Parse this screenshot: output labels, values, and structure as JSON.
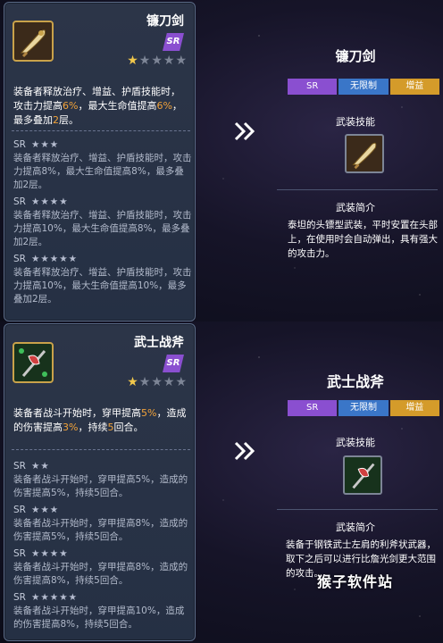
{
  "top": {
    "card": {
      "name": "镰刀剑",
      "rarity": "SR",
      "stars_on": 1,
      "stars_total": 5,
      "desc_parts": [
        "装备者释放治疗、增益、护盾技能时，攻击力提高",
        "6%",
        "，最大生命值提高",
        "6%",
        "，最多叠加",
        "2",
        "层。"
      ],
      "tiers": [
        {
          "head": "SR",
          "stars": "★★★",
          "text": "装备者释放治疗、增益、护盾技能时，攻击力提高8%，最大生命值提高8%，最多叠加2层。"
        },
        {
          "head": "SR",
          "stars": "★★★★",
          "text": "装备者释放治疗、增益、护盾技能时，攻击力提高10%，最大生命值提高8%，最多叠加2层。"
        },
        {
          "head": "SR",
          "stars": "★★★★★",
          "text": "装备者释放治疗、增益、护盾技能时，攻击力提高10%，最大生命值提高10%，最多叠加2层。"
        }
      ]
    },
    "right": {
      "title": "镰刀剑",
      "tags": [
        "SR",
        "无限制",
        "增益"
      ],
      "skill_label": "武装技能",
      "intro_label": "武装简介",
      "intro": "泰坦的头镖型武装，平时安置在头部上，在使用时会自动弹出，具有强大的攻击力。"
    }
  },
  "bottom": {
    "card": {
      "name": "武士战斧",
      "rarity": "SR",
      "stars_on": 1,
      "stars_total": 5,
      "desc_parts": [
        "装备者战斗开始时，穿甲提高",
        "5%",
        "，造成的伤害提高",
        "3%",
        "，持续",
        "5",
        "回合。"
      ],
      "tiers": [
        {
          "head": "SR",
          "stars": "★★",
          "text": "装备者战斗开始时，穿甲提高5%，造成的伤害提高5%，持续5回合。"
        },
        {
          "head": "SR",
          "stars": "★★★",
          "text": "装备者战斗开始时，穿甲提高8%，造成的伤害提高5%，持续5回合。"
        },
        {
          "head": "SR",
          "stars": "★★★★",
          "text": "装备者战斗开始时，穿甲提高8%，造成的伤害提高8%，持续5回合。"
        },
        {
          "head": "SR",
          "stars": "★★★★★",
          "text": "装备者战斗开始时，穿甲提高10%，造成的伤害提高8%，持续5回合。"
        }
      ]
    },
    "right": {
      "title": "武士战斧",
      "tags": [
        "SR",
        "无限制",
        "增益"
      ],
      "skill_label": "武装技能",
      "intro_label": "武装简介",
      "intro": "装备于钢铁武士左肩的利斧状武器，取下之后可以进行比詹光剑更大范围的攻击。"
    }
  },
  "watermark": "猴子软件站",
  "icons": {
    "scythe": "scythe-sword-icon",
    "axe": "battle-axe-icon",
    "arrow": "double-chevron-right-icon",
    "star": "star-icon"
  },
  "colors": {
    "highlight": "#f2a33a",
    "star_on": "#f2c84b",
    "tag_sr": "#8a4fd0",
    "tag_unlimited": "#3a76c8",
    "tag_buff": "#d49b2a"
  }
}
